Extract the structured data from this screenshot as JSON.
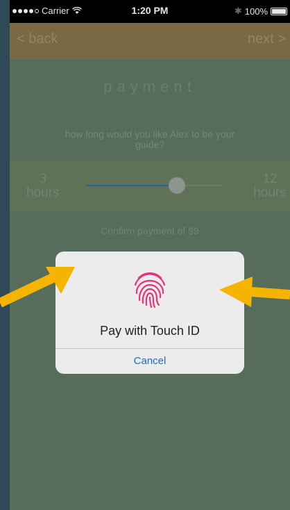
{
  "status_bar": {
    "carrier": "Carrier",
    "time": "1:20 PM",
    "battery": "100%",
    "battery_level": 1.0
  },
  "nav": {
    "back_label": "< back",
    "next_label": "next >"
  },
  "page": {
    "title": "payment",
    "question": "how long would you like Alex to be your guide?",
    "confirm_text": "Confirm payment of $9"
  },
  "slider": {
    "min_value": "3",
    "min_unit": "hours",
    "max_value": "12",
    "max_unit": "hours",
    "min": 3,
    "max": 12,
    "value": 9
  },
  "dialog": {
    "icon": "fingerprint-icon",
    "message": "Pay with Touch ID",
    "cancel_label": "Cancel"
  },
  "colors": {
    "screen_bg": "#566d5b",
    "nav_bg": "#7a6a43",
    "accent_arrow": "#f4b400",
    "fingerprint": "#e8327c",
    "link_blue": "#1a6ed8"
  }
}
